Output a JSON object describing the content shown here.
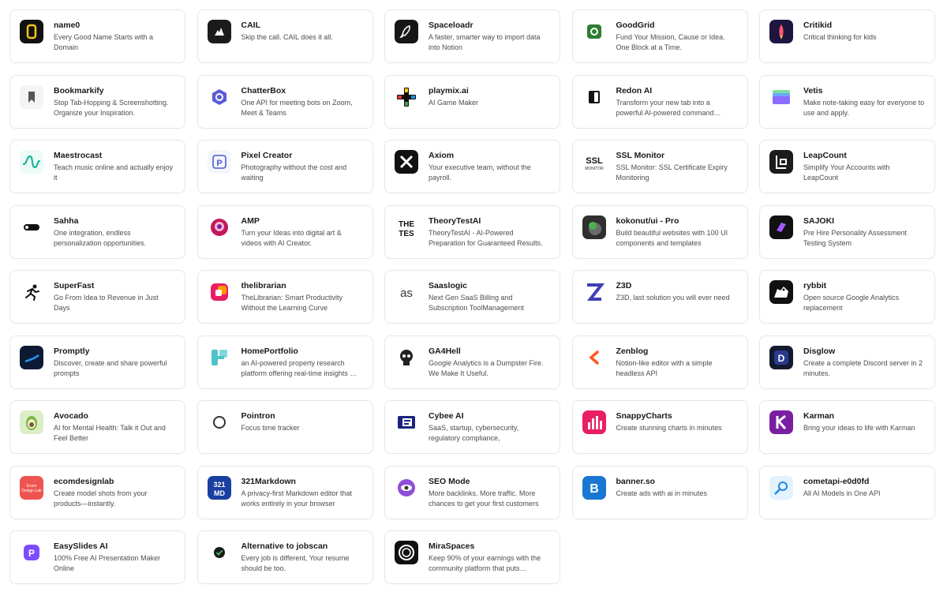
{
  "products": [
    {
      "name": "name0",
      "description": "Every Good Name Starts with a Domain",
      "icon": "name0-logo-icon"
    },
    {
      "name": "CAIL",
      "description": "Skip the call. CAIL does it all.",
      "icon": "cail-logo-icon"
    },
    {
      "name": "Spaceloadr",
      "description": "A faster, smarter way to import data into Notion",
      "icon": "rocket-icon"
    },
    {
      "name": "GoodGrid",
      "description": "Fund Your Mission, Cause or Idea. One Block at a Time.",
      "icon": "goodgrid-logo-icon"
    },
    {
      "name": "Critikid",
      "description": "Critical thinking for kids",
      "icon": "critikid-rocket-icon"
    },
    {
      "name": "Bookmarkify",
      "description": "Stop Tab-Hopping & Screenshotting. Organize your Inspiration.",
      "icon": "bookmark-icon"
    },
    {
      "name": "ChatterBox",
      "description": "One API for meeting bots on Zoom, Meet & Teams",
      "icon": "hexagon-chat-icon"
    },
    {
      "name": "playmix.ai",
      "description": "AI Game Maker",
      "icon": "gamepad-icon"
    },
    {
      "name": "Redon AI",
      "description": "Transform your new tab into a powerful AI-powered command…",
      "icon": "redon-logo-icon"
    },
    {
      "name": "Vetis",
      "description": "Make note-taking easy for everyone to use and apply.",
      "icon": "folder-stack-icon"
    },
    {
      "name": "Maestrocast",
      "description": "Teach music online and actually enjoy it",
      "icon": "wave-icon"
    },
    {
      "name": "Pixel Creator",
      "description": "Photography without the cost and waiting",
      "icon": "pixel-p-icon"
    },
    {
      "name": "Axiom",
      "description": "Your executive team, without the payroll.",
      "icon": "axiom-x-icon"
    },
    {
      "name": "SSL Monitor",
      "description": "SSL Monitor: SSL Certificate Expiry Monitoring",
      "icon": "ssl-logo-icon"
    },
    {
      "name": "LeapCount",
      "description": "Simplify Your Accounts with LeapCount",
      "icon": "leapcount-logo-icon"
    },
    {
      "name": "Sahha",
      "description": "One integration, endless personalization opportunities.",
      "icon": "sahha-logo-icon"
    },
    {
      "name": "AMP",
      "description": "Turn your Ideas into digital art & videos with AI Creator.",
      "icon": "amp-avatar-icon"
    },
    {
      "name": "TheoryTestAI",
      "description": "TheoryTestAI - AI-Powered Preparation for Guaranteed Results.",
      "icon": "theory-test-logo-icon"
    },
    {
      "name": "kokonut/ui - Pro",
      "description": "Build beautiful websites with 100 UI components and templates",
      "icon": "kokonut-logo-icon"
    },
    {
      "name": "SAJOKI",
      "description": "Pre Hire Personality Assessment Testing System",
      "icon": "sajoki-logo-icon"
    },
    {
      "name": "SuperFast",
      "description": "Go From Idea to Revenue in Just Days",
      "icon": "runner-icon"
    },
    {
      "name": "thelibrarian",
      "description": "TheLibrarian: Smart Productivity Without the Learning Curve",
      "icon": "librarian-logo-icon"
    },
    {
      "name": "Saaslogic",
      "description": "Next Gen SaaS Billing and Subscription ToolManagement",
      "icon": "saaslogic-logo-icon"
    },
    {
      "name": "Z3D",
      "description": "Z3D, last solution you will ever need",
      "icon": "z3d-logo-icon"
    },
    {
      "name": "rybbit",
      "description": "Open source Google Analytics replacement",
      "icon": "frog-icon"
    },
    {
      "name": "Promptly",
      "description": "Discover, create and share powerful prompts",
      "icon": "promptly-logo-icon"
    },
    {
      "name": "HomePortfolio",
      "description": "an AI-powered property research platform offering real-time insights …",
      "icon": "homeportfolio-logo-icon"
    },
    {
      "name": "GA4Hell",
      "description": "Google Analytics is a Dumpster Fire. We Make It Useful.",
      "icon": "skull-icon"
    },
    {
      "name": "Zenblog",
      "description": "Notion-like editor with a simple headless API",
      "icon": "zenblog-logo-icon"
    },
    {
      "name": "Disglow",
      "description": "Create a complete Discord server in 2 minutes.",
      "icon": "disglow-logo-icon"
    },
    {
      "name": "Avocado",
      "description": "AI for Mental Health: Talk it Out and Feel Better",
      "icon": "avocado-icon"
    },
    {
      "name": "Pointron",
      "description": "Focus time tracker",
      "icon": "ring-icon"
    },
    {
      "name": "Cybee AI",
      "description": "SaaS, startup, cybersecurity, regulatory compliance,",
      "icon": "cybee-logo-icon"
    },
    {
      "name": "SnappyCharts",
      "description": "Create stunning charts in minutes",
      "icon": "bar-chart-icon"
    },
    {
      "name": "Karman",
      "description": "Bring your ideas to life with Karman",
      "icon": "karman-logo-icon"
    },
    {
      "name": "ecomdesignlab",
      "description": "Create model shots from your products—instantly.",
      "icon": "ecomdesignlab-logo-icon"
    },
    {
      "name": "321Markdown",
      "description": "A privacy-first Markdown editor that works entirely in your browser",
      "icon": "markdown-logo-icon"
    },
    {
      "name": "SEO Mode",
      "description": "More backlinks. More traffic. More chances to get your first customers",
      "icon": "eye-icon"
    },
    {
      "name": "banner.so",
      "description": "Create ads with ai in minutes",
      "icon": "banner-b-icon"
    },
    {
      "name": "cometapi-e0d0fd",
      "description": "All AI Models in One API",
      "icon": "comet-icon"
    },
    {
      "name": "EasySlides AI",
      "description": "100% Free AI Presentation Maker Online",
      "icon": "easyslides-logo-icon"
    },
    {
      "name": "Alternative to jobscan",
      "description": "Every job is different, Your resume should be too.",
      "icon": "check-badge-icon"
    },
    {
      "name": "MiraSpaces",
      "description": "Keep 90% of your earnings with the community platform that puts…",
      "icon": "mira-logo-icon"
    }
  ],
  "icon_art": {
    "name0-logo-icon": "<rect width='30' height='30' rx='6' fill='#111'/><rect x='10' y='7' width='10' height='16' rx='3' fill='none' stroke='#f5c518' stroke-width='2.5'/>",
    "cail-logo-icon": "<rect width='30' height='30' rx='6' fill='#1b1b1b'/><path d='M9 20 L13 13 L15 16 L17 10 L21 20 Z' fill='#fff'/>",
    "rocket-icon": "<rect width='30' height='30' rx='6' fill='#161616'/><path d='M19 8 C14 9 11 14 10 19 L13 20 C16 17 20 13 19 8 Z M10 19 L8 22 L11 21' fill='none' stroke='#fff' stroke-width='1.5'/>",
    "goodgrid-logo-icon": "<rect width='30' height='30' rx='6' fill='#fff'/><rect x='6' y='6' width='18' height='18' rx='4' fill='#2e7d32'/><circle cx='15' cy='15' r='4' fill='none' stroke='#fff' stroke-width='2'/>",
    "critikid-rocket-icon": "<rect width='30' height='30' rx='6' fill='#1e1540'/><path d='M15 6 C18 10 18 16 17 20 L13 20 C12 16 12 10 15 6 Z' fill='#ff5a6e'/><path d='M13 20 L15 25 L17 20 Z' fill='#ffb74d'/>",
    "bookmark-icon": "<rect width='30' height='30' rx='6' fill='#f4f4f4'/><path d='M11 8 H19 V22 L15 18 L11 22 Z' fill='#555'/>",
    "hexagon-chat-icon": "<rect width='30' height='30' rx='6' fill='#fff'/><path d='M15 5 L24 10 L24 20 L15 25 L6 20 L6 10 Z' fill='#5b5bd6'/><circle cx='15' cy='15' r='4' fill='none' stroke='#fff' stroke-width='2'/>",
    "gamepad-icon": "<rect width='30' height='30' rx='6' fill='#fff'/><rect x='12' y='3' width='6' height='24' rx='1' fill='#111'/><rect x='3' y='12' width='24' height='6' rx='1' fill='#111'/><rect x='13' y='4' width='4' height='5' fill='#f5c518'/><rect x='4' y='13' width='5' height='4' fill='#e53935'/><rect x='21' y='13' width='5' height='4' fill='#1e88e5'/><rect x='13' y='21' width='4' height='5' fill='#43a047'/>",
    "redon-logo-icon": "<rect width='30' height='30' rx='6' fill='#fff'/><rect x='8' y='7' width='14' height='16' rx='2' fill='#111'/><rect x='15' y='9' width='5' height='12' fill='#fff'/>",
    "folder-stack-icon": "<rect width='30' height='30' rx='6' fill='#fff'/><rect x='4' y='6' width='22' height='7' rx='2' fill='#7ee0a0'/><rect x='4' y='10' width='22' height='8' rx='2' fill='#6aa8ff'/><rect x='4' y='14' width='22' height='10' rx='2' fill='#8c6cff'/>",
    "wave-icon": "<rect width='30' height='30' rx='6' fill='#eefaf7'/><path d='M5 18 C9 18 9 8 13 8 C17 8 15 22 19 22 C23 22 22 14 25 14' fill='none' stroke='#1fb39b' stroke-width='2.2' stroke-linecap='round'/>",
    "pixel-p-icon": "<rect width='30' height='30' rx='6' fill='#f5f6fb'/><rect x='7' y='7' width='16' height='16' rx='3' fill='none' stroke='#4a5ad6' stroke-width='1.6'/><text x='15' y='20' font-size='11' font-weight='700' text-anchor='middle' fill='#4a5ad6' font-family='Liberation Sans, sans-serif'>P</text>",
    "axiom-x-icon": "<rect width='30' height='30' rx='6' fill='#111'/><path d='M8 8 L22 22 M22 8 L8 22' stroke='#fff' stroke-width='3'/>",
    "ssl-logo-icon": "<rect width='30' height='30' rx='6' fill='#fff'/><text x='15' y='17' font-size='11' font-weight='700' text-anchor='middle' fill='#111' font-family='Liberation Sans, sans-serif'>SSL</text><text x='15' y='25' font-size='5' text-anchor='middle' fill='#333' font-family='Liberation Sans, sans-serif'>MONITOR</text>",
    "leapcount-logo-icon": "<rect width='30' height='30' rx='6' fill='#1c1c1c'/><path d='M9 7 V23 H21 M14 12 H21 V18 H14 Z' fill='none' stroke='#fff' stroke-width='2'/>",
    "sahha-logo-icon": "<rect width='30' height='30' rx='6' fill='#fff'/><rect x='5' y='11' width='20' height='8' rx='4' fill='#111'/><circle cx='9' cy='15' r='2' fill='#fff'/>",
    "amp-avatar-icon": "<rect width='30' height='30' rx='6' fill='#fff'/><circle cx='15' cy='15' r='11' fill='#c2185b'/><circle cx='15' cy='14' r='6' fill='#f8bbd0'/><circle cx='15' cy='14' r='3' fill='#7b1fa2'/>",
    "theory-test-logo-icon": "<rect width='30' height='30' rx='6' fill='#fff'/><text x='15' y='14' font-size='10' font-weight='700' text-anchor='middle' fill='#111' font-family='Liberation Sans, sans-serif'>THE</text><text x='15' y='26' font-size='10' font-weight='700' text-anchor='middle' fill='#111' font-family='Liberation Sans, sans-serif'>TES</text>",
    "kokonut-logo-icon": "<rect width='30' height='30' rx='6' fill='#2f2f2f'/><circle cx='16' cy='17' r='8' fill='#6b6b6b'/><circle cx='13' cy='13' r='5' fill='#4caf50'/>",
    "sajoki-logo-icon": "<rect width='30' height='30' rx='6' fill='#111'/><path d='M9 19 L15 9 L21 11 L15 21 Z' fill='#a259ff'/>",
    "runner-icon": "<rect width='30' height='30' rx='6' fill='#fff'/><circle cx='19' cy='8' r='2.5' fill='#111'/><path d='M10 14 L16 11 L20 15 L24 14 M16 11 L13 18 L8 22 M14 17 L19 21 L18 25' fill='none' stroke='#111' stroke-width='2' stroke-linecap='round'/>",
    "librarian-logo-icon": "<rect width='30' height='30' rx='6' fill='#fff'/><rect x='4' y='4' width='22' height='22' rx='6' fill='#e91e63'/><rect x='13' y='7' width='11' height='11' rx='3' fill='#ff9800'/><rect x='10' y='12' width='8' height='8' rx='2' fill='#fff'/>",
    "saaslogic-logo-icon": "<rect width='30' height='30' rx='6' fill='#fff'/><text x='15' y='21' font-size='15' text-anchor='middle' fill='#333' font-family='Liberation Sans, sans-serif'>as</text>",
    "z3d-logo-icon": "<rect width='30' height='30' rx='6' fill='#fff'/><path d='M6 6 H24 L10 24 H24' fill='none' stroke='#3f3fb5' stroke-width='4'/>",
    "frog-icon": "<rect width='30' height='30' rx='6' fill='#111'/><path d='M6 22 L10 11 L14 13 L18 8 L24 14 L22 22 Z' fill='#fff'/><circle cx='18' cy='12' r='1.5' fill='#111'/>",
    "promptly-logo-icon": "<rect width='30' height='30' rx='6' fill='#0d1a33'/><path d='M7 20 C12 18 18 17 24 12' stroke='#2196f3' stroke-width='2.5' fill='none'/>",
    "homeportfolio-logo-icon": "<rect width='30' height='30' rx='6' fill='#fff'/><rect x='5' y='5' width='8' height='20' rx='2' fill='#4fc3c9'/><rect x='15' y='5' width='10' height='10' rx='2' fill='#80d8dd'/><rect x='13' y='13' width='8' height='4' fill='#4fc3c9'/>",
    "skull-icon": "<rect width='30' height='30' rx='6' fill='#fff'/><circle cx='15' cy='13' r='8' fill='#222'/><circle cx='12' cy='13' r='2' fill='#fff'/><circle cx='18' cy='13' r='2' fill='#fff'/><rect x='11' y='20' width='8' height='5' fill='#222'/>",
    "zenblog-logo-icon": "<rect width='30' height='30' rx='6' fill='#fff'/><path d='M19 8 L11 15 L19 22' fill='none' stroke='#ff5722' stroke-width='3.5' stroke-linecap='round'/>",
    "disglow-logo-icon": "<rect width='30' height='30' rx='6' fill='#141a2e'/><rect x='6' y='6' width='18' height='18' rx='4' fill='#2a3a8f'/><text x='15' y='20' font-size='12' font-weight='700' text-anchor='middle' fill='#fff' font-family='Liberation Sans, sans-serif'>D</text>",
    "avocado-icon": "<rect width='30' height='30' rx='6' fill='#dcedc8'/><ellipse cx='15' cy='16' rx='7' ry='9' fill='#7cb342'/><ellipse cx='15' cy='17' rx='5' ry='6' fill='#f0f4c3'/><circle cx='15' cy='18' r='3' fill='#795548'/>",
    "ring-icon": "<rect width='30' height='30' rx='6' fill='#fff'/><circle cx='15' cy='15' r='7' fill='none' stroke='#333' stroke-width='2'/>",
    "cybee-logo-icon": "<rect width='30' height='30' rx='6' fill='#fff'/><rect x='4' y='7' width='22' height='16' rx='2' fill='#1a237e'/><rect x='10' y='10' width='12' height='10' fill='#fff'/><rect x='12' y='12' width='8' height='2' fill='#1a237e'/><rect x='12' y='16' width='6' height='2' fill='#1a237e'/>",
    "bar-chart-icon": "<rect width='30' height='30' rx='6' fill='#e91e63'/><rect x='7' y='15' width='3' height='9' fill='#fff'/><rect x='12' y='10' width='3' height='14' fill='#fff'/><rect x='17' y='7' width='3' height='17' fill='#fff'/><rect x='22' y='13' width='3' height='11' fill='#fff'/>",
    "karman-logo-icon": "<rect width='30' height='30' rx='6' fill='#7b1fa2'/><path d='M10 7 V23 M10 15 L20 7 M12 14 L20 23' stroke='#fff' stroke-width='3'/>",
    "ecomdesignlab-logo-icon": "<rect width='30' height='30' rx='6' fill='#ef5350'/><text x='15' y='14' font-size='5' text-anchor='middle' fill='#fff' font-family='Liberation Sans, sans-serif'>Ecom</text><text x='15' y='20' font-size='5' text-anchor='middle' fill='#fff' font-family='Liberation Sans, sans-serif'>Design Lab</text>",
    "markdown-logo-icon": "<rect width='30' height='30' rx='6' fill='#1a3fa0'/><text x='15' y='14' font-size='9' font-weight='700' text-anchor='middle' fill='#fff' font-family='Liberation Sans, sans-serif'>321</text><text x='15' y='25' font-size='9' font-weight='700' text-anchor='middle' fill='#fff' font-family='Liberation Sans, sans-serif'>MD</text>",
    "eye-icon": "<rect width='30' height='30' rx='6' fill='#fff'/><circle cx='15' cy='15' r='11' fill='#8e4ed9'/><ellipse cx='15' cy='15' rx='7' ry='4' fill='#fff'/><circle cx='15' cy='15' r='2.5' fill='#333'/>",
    "banner-b-icon": "<rect width='30' height='30' rx='6' fill='#1976d2'/><text x='15' y='21' font-size='16' font-weight='700' text-anchor='middle' fill='#fff' font-family='Liberation Sans, sans-serif'>B</text>",
    "comet-icon": "<rect width='30' height='30' rx='6' fill='#e3f2fd'/><circle cx='17' cy='13' r='5' fill='none' stroke='#1e88e5' stroke-width='2'/><path d='M13 17 L7 23' stroke='#1e88e5' stroke-width='2.5'/>",
    "easyslides-logo-icon": "<rect width='30' height='30' rx='6' fill='#fff'/><rect x='5' y='5' width='20' height='20' rx='6' fill='#7c4dff'/><text x='15' y='20' font-size='12' font-weight='700' text-anchor='middle' fill='#fff' font-family='Liberation Sans, sans-serif'>P</text>",
    "check-badge-icon": "<rect width='30' height='30' rx='6' fill='#fff'/><circle cx='15' cy='15' r='7' fill='#1b1b1b'/><path d='M11.5 15 L14 17.5 L18.5 12.5' fill='none' stroke='#4caf50' stroke-width='2'/>",
    "mira-logo-icon": "<rect width='30' height='30' rx='6' fill='#111'/><circle cx='15' cy='15' r='9' fill='none' stroke='#fff' stroke-width='2'/><circle cx='15' cy='15' r='5' fill='none' stroke='#fff' stroke-width='1.5'/>"
  }
}
